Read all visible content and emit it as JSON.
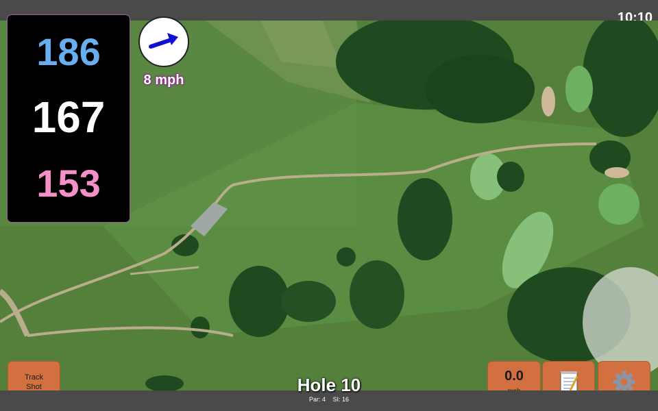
{
  "status_bar": {
    "time": "10:10"
  },
  "distances": {
    "back": "186",
    "middle": "167",
    "front": "153"
  },
  "wind": {
    "speed": "8 mph",
    "direction_icon": "wind-arrow-icon"
  },
  "buttons": {
    "track_shot": {
      "line1": "Track",
      "line2": "Shot"
    },
    "speed": {
      "value": "0.0",
      "unit": "mph"
    },
    "notes_icon": "notepad-icon",
    "settings_icon": "gear-icon"
  },
  "hole": {
    "title": "Hole 10",
    "par": "Par: 4",
    "si": "SI: 16"
  },
  "colors": {
    "back_distance": "#69aef0",
    "middle_distance": "#ffffff",
    "front_distance": "#f48fc8",
    "button_orange": "#d2703f",
    "bar_gray": "#4a4a4a"
  }
}
